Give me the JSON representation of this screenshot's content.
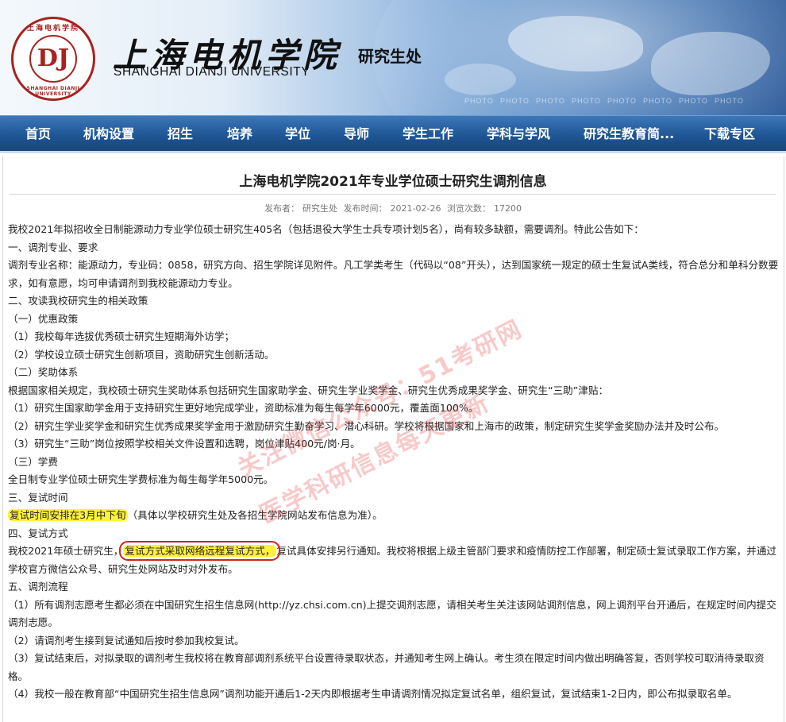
{
  "colors": {
    "nav_bg": "#1f5696",
    "brand_red": "#a8221f",
    "highlight": "#fff23a",
    "box_red": "#d2221c",
    "watermark": "#e63c3c"
  },
  "header": {
    "university_cn": "上海电机学院",
    "university_en": "SHANGHAI DIANJI UNIVERSITY",
    "department": "研究生处",
    "logo": {
      "ring_text_top": "上海电机学院",
      "ring_text_bottom": "SHANGHAI DIANJI UNIVERSITY",
      "monogram": "DJ"
    },
    "photo_labels": [
      "PHOTO",
      "PHOTO",
      "PHOTO",
      "PHOTO",
      "PHOTO",
      "PHOTO",
      "PHOTO",
      "PHOTO"
    ]
  },
  "nav": {
    "items": [
      "首页",
      "机构设置",
      "招生",
      "培养",
      "学位",
      "导师",
      "学生工作",
      "学科与学风",
      "研究生教育简...",
      "下载专区"
    ]
  },
  "article": {
    "title": "上海电机学院2021年专业学位硕士研究生调剂信息",
    "meta": {
      "publisher_label": "发布者：",
      "publisher": "研究生处",
      "time_label": "发布时间：",
      "time": "2021-02-26",
      "views_label": "浏览次数：",
      "views": "17200"
    },
    "paragraphs": {
      "p1": "我校2021年拟招收全日制能源动力专业学位硕士研究生405名（包括退役大学生士兵专项计划5名），尚有较多缺额，需要调剂。特此公告如下：",
      "p2": "一、调剂专业、要求",
      "p3": "调剂专业名称：能源动力，专业码：0858，研究方向、招生学院详见附件。凡工学类考生（代码以“08”开头），达到国家统一规定的硕士生复试A类线，符合总分和单科分数要求，如有意愿，均可申请调剂到我校能源动力专业。",
      "p4": "二、攻读我校研究生的相关政策",
      "p5": "（一）优惠政策",
      "p6": "（1）我校每年选拔优秀硕士研究生短期海外访学；",
      "p7": "（2）学校设立硕士研究生创新项目，资助研究生创新活动。",
      "p8": "（二）奖助体系",
      "p9": "根据国家相关规定，我校硕士研究生奖助体系包括研究生国家助学金、研究生学业奖学金、研究生优秀成果奖学金、研究生“三助”津贴：",
      "p10": "（1）研究生国家助学金用于支持研究生更好地完成学业，资助标准为每生每学年6000元，覆盖面100%。",
      "p11": "（2）研究生学业奖学金和研究生优秀成果奖学金用于激励研究生勤奋学习、潜心科研。学校将根据国家和上海市的政策，制定研究生奖学金奖励办法并及时公布。",
      "p12": "（3）研究生“三助”岗位按照学校相关文件设置和选聘，岗位津贴400元/岗·月。",
      "p13": "（三）学费",
      "p14": "全日制专业学位硕士研究生学费标准为每生每学年5000元。",
      "p15": "三、复试时间",
      "p16_hl": "复试时间安排在3月中下旬",
      "p16_rest": "（具体以学校研究生处及各招生学院网站发布信息为准）。",
      "p17": "四、复试方式",
      "p18_pre": "我校2021年硕士研究生，",
      "p18_hl": "复试方式采取网络远程复试方式，",
      "p18_rest": "复试具体安排另行通知。我校将根据上级主管部门要求和疫情防控工作部署，制定硕士复试录取工作方案，并通过学校官方微信公众号、研究生处网站及时对外发布。",
      "p19": "五、调剂流程",
      "p20": "（1）所有调剂志愿考生都必须在中国研究生招生信息网(http://yz.chsi.com.cn)上提交调剂志愿，请相关考生关注该网站调剂信息，网上调剂平台开通后，在规定时间内提交调剂志愿。",
      "p21": "（2）请调剂考生接到复试通知后按时参加我校复试。",
      "p22": "（3）复试结束后，对拟录取的调剂考生我校将在教育部调剂系统平台设置待录取状态，并通知考生网上确认。考生须在限定时间内做出明确答复，否则学校可取消待录取资格。",
      "p23": "（4）我校一般在教育部“中国研究生招生信息网”调剂功能开通后1-2天内即根据考生申请调剂情况拟定复试名单，组织复试，复试结束1-2日内，即公布拟录取名单。"
    }
  },
  "watermark": {
    "line1": "关注微信公众号：51考研网",
    "line2": "医学科研信息每天更新"
  }
}
